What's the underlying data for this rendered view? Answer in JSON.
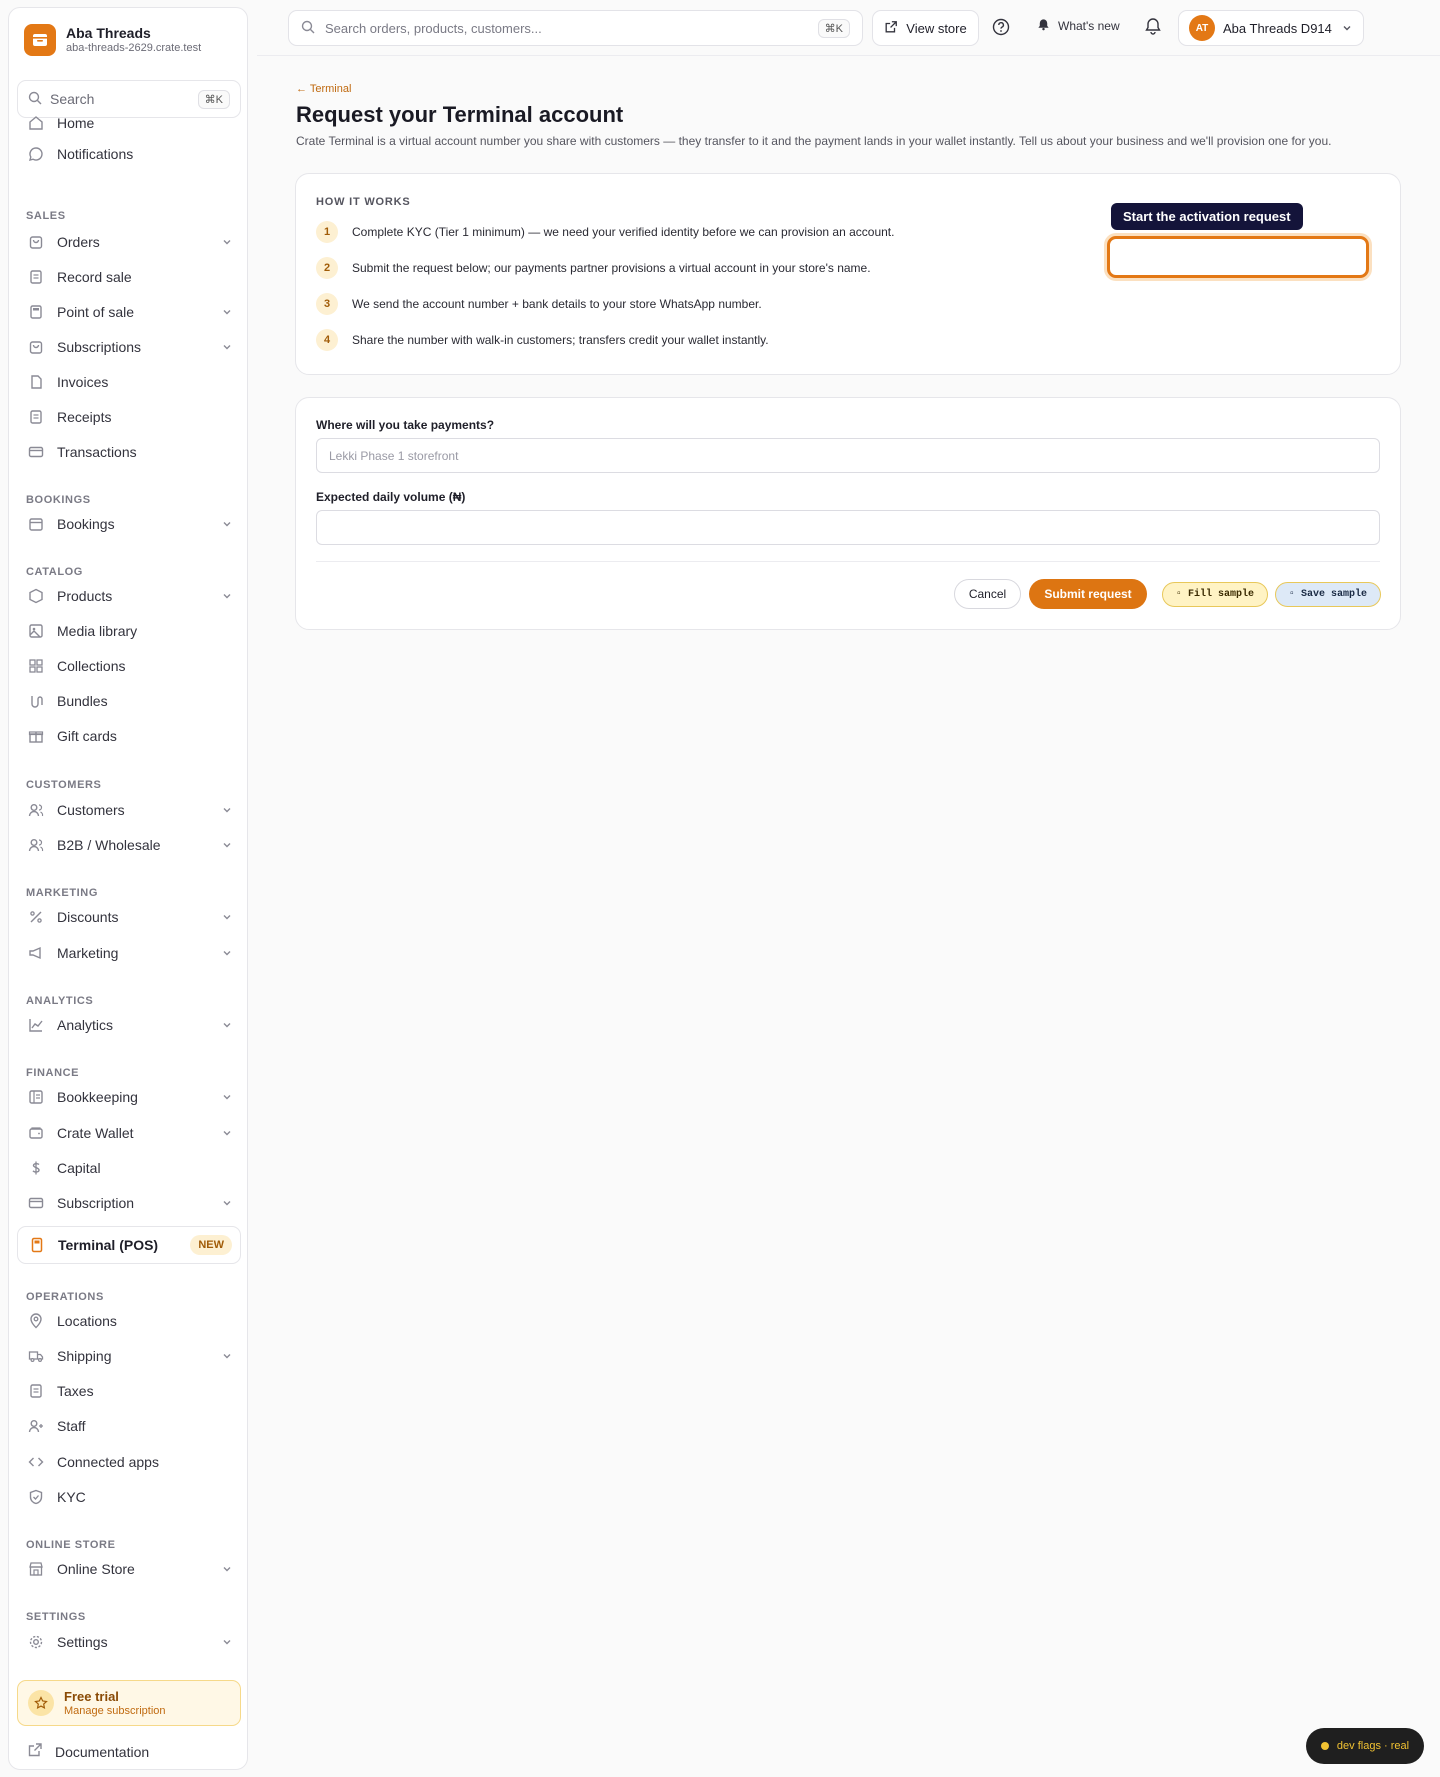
{
  "brand": {
    "name": "Aba Threads",
    "url": "aba-threads-2629.crate.test"
  },
  "sidebar_search": {
    "label": "Search",
    "shortcut": "⌘K"
  },
  "nav": {
    "home": "Home",
    "notifications": "Notifications",
    "sales_label": "SALES",
    "orders": "Orders",
    "record_sale": "Record sale",
    "point_of_sale": "Point of sale",
    "subscriptions": "Subscriptions",
    "invoices": "Invoices",
    "receipts": "Receipts",
    "transactions": "Transactions",
    "bookings_label": "BOOKINGS",
    "bookings": "Bookings",
    "catalog_label": "CATALOG",
    "products": "Products",
    "media_library": "Media library",
    "collections": "Collections",
    "bundles": "Bundles",
    "gift_cards": "Gift cards",
    "customers_label": "CUSTOMERS",
    "customers": "Customers",
    "b2b": "B2B / Wholesale",
    "marketing_label": "MARKETING",
    "discounts": "Discounts",
    "marketing": "Marketing",
    "analytics_label": "ANALYTICS",
    "analytics": "Analytics",
    "finance_label": "FINANCE",
    "bookkeeping": "Bookkeeping",
    "crate_wallet": "Crate Wallet",
    "capital": "Capital",
    "subscription": "Subscription",
    "terminal": "Terminal (POS)",
    "terminal_badge": "NEW",
    "operations_label": "OPERATIONS",
    "locations": "Locations",
    "shipping": "Shipping",
    "taxes": "Taxes",
    "staff": "Staff",
    "connected_apps": "Connected apps",
    "kyc": "KYC",
    "online_store_label": "ONLINE STORE",
    "online_store": "Online Store",
    "settings_label": "SETTINGS",
    "settings": "Settings"
  },
  "trial": {
    "title": "Free trial",
    "subtitle": "Manage subscription"
  },
  "documentation": "Documentation",
  "topbar": {
    "search_placeholder": "Search orders, products, customers...",
    "search_shortcut": "⌘K",
    "view_store": "View store",
    "whats_new": "What's new",
    "store_name": "Aba Threads D914",
    "avatar_initials": "AT"
  },
  "page": {
    "back_link": "← Terminal",
    "title": "Request your Terminal account",
    "description": "Crate Terminal is a virtual account number you share with customers — they transfer to it and the payment lands in your wallet instantly. Tell us about your business and we'll provision one for you."
  },
  "how_it_works": {
    "heading": "HOW IT WORKS",
    "steps": [
      {
        "num": "1",
        "text": "Complete KYC (Tier 1 minimum) — we need your verified identity before we can provision an account."
      },
      {
        "num": "2",
        "text": "Submit the request below; our payments partner provisions a virtual account in your store's name."
      },
      {
        "num": "3",
        "text": "We send the account number + bank details to your store WhatsApp number."
      },
      {
        "num": "4",
        "text": "Share the number with walk-in customers; transfers credit your wallet instantly."
      }
    ],
    "tooltip": "Start the activation request"
  },
  "form": {
    "location_label": "Where will you take payments?",
    "location_placeholder": "Lekki Phase 1 storefront",
    "location_value": "",
    "volume_label": "Expected daily volume (₦)",
    "volume_value": "",
    "cancel": "Cancel",
    "submit": "Submit request",
    "fill_sample": "▫ Fill sample",
    "save_sample": "▫ Save sample"
  },
  "dev_flags": "dev flags · real",
  "colors": {
    "accent": "#e37815",
    "tooltip_bg": "#14143a",
    "badge_bg": "#fdf0d2"
  }
}
